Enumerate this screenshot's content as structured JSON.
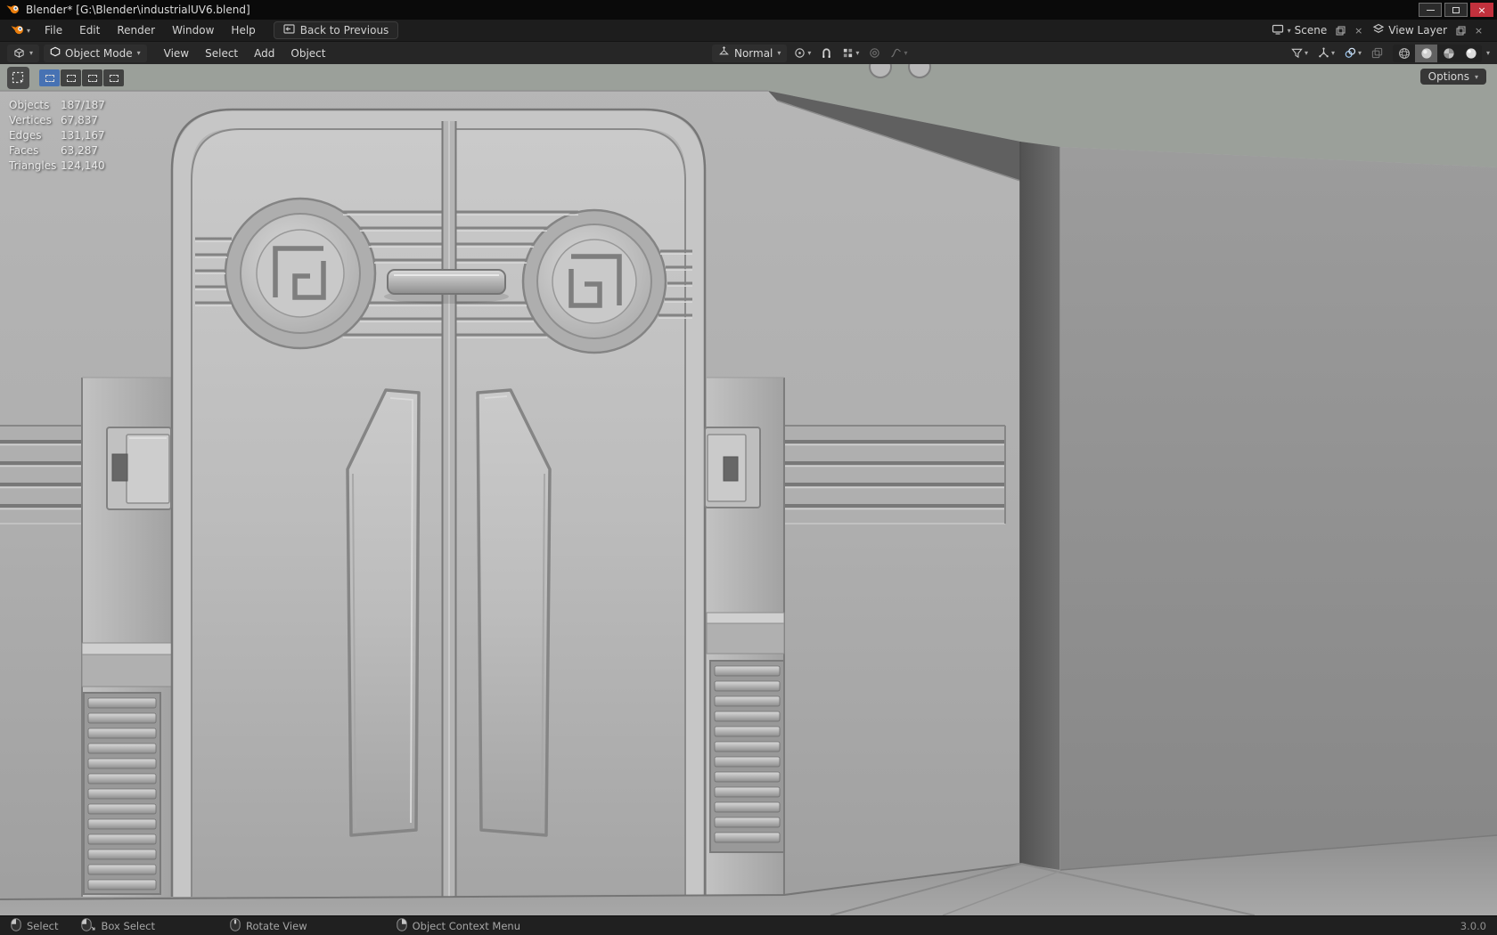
{
  "colors": {
    "accent_blue": "#4772b3",
    "blender_orange": "#e87d0d",
    "close_red": "#c2313d"
  },
  "icons": {
    "caret": "▾",
    "close": "×"
  },
  "window": {
    "title": "Blender* [G:\\Blender\\industrialUV6.blend]"
  },
  "menubar": {
    "menus": [
      "File",
      "Edit",
      "Render",
      "Window",
      "Help"
    ],
    "back_button": "Back to Previous",
    "scene_selector": "Scene",
    "view_layer_selector": "View Layer"
  },
  "viewport_header": {
    "mode": "Object Mode",
    "menus": [
      "View",
      "Select",
      "Add",
      "Object"
    ],
    "orientation": "Normal",
    "options_button": "Options"
  },
  "viewport": {
    "stats": [
      {
        "label": "Objects",
        "value": "187/187"
      },
      {
        "label": "Vertices",
        "value": "67,837"
      },
      {
        "label": "Edges",
        "value": "131,167"
      },
      {
        "label": "Faces",
        "value": "63,287"
      },
      {
        "label": "Triangles",
        "value": "124,140"
      }
    ]
  },
  "statusbar": {
    "hints": [
      {
        "label": "Select"
      },
      {
        "label": "Box Select"
      },
      {
        "label": "Rotate View"
      },
      {
        "label": "Object Context Menu"
      }
    ],
    "version": "3.0.0"
  }
}
